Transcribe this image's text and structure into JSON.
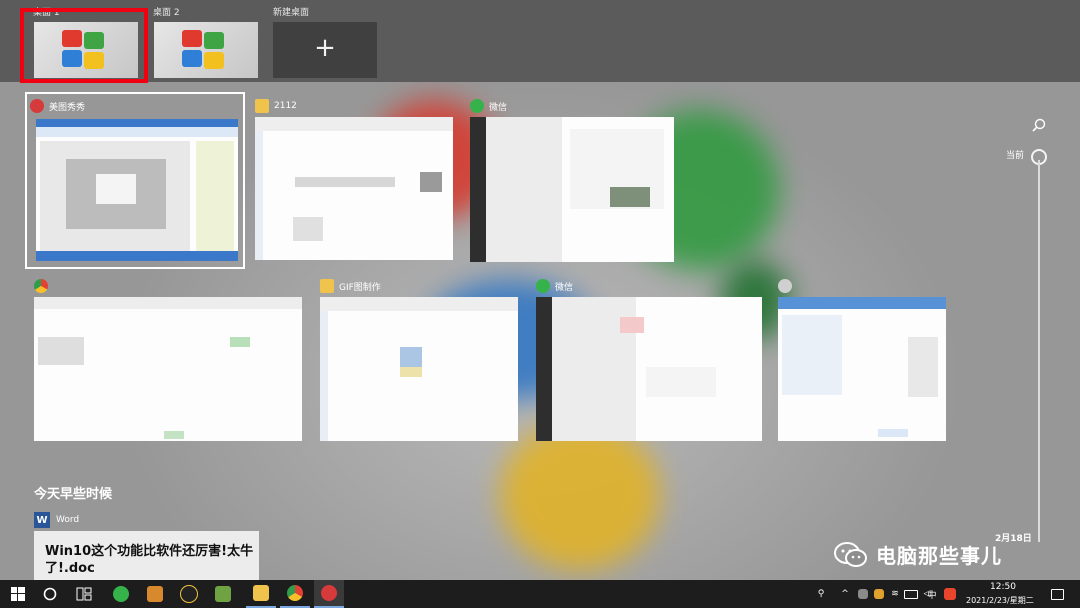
{
  "desktops": {
    "items": [
      {
        "label": "桌面 1",
        "selected": true
      },
      {
        "label": "桌面 2",
        "selected": false
      }
    ],
    "new_label": "新建桌面",
    "new_icon": "plus-icon"
  },
  "windows": [
    {
      "title": "美图秀秀",
      "icon": "meitu-icon",
      "selected": true
    },
    {
      "title": "2112",
      "icon": "folder-icon"
    },
    {
      "title": "微信",
      "icon": "wechat-icon"
    },
    {
      "title": "",
      "icon": "chrome-icon"
    },
    {
      "title": "GIF图制作",
      "icon": "folder-icon"
    },
    {
      "title": "微信",
      "icon": "wechat-icon"
    },
    {
      "title": "",
      "icon": "app-icon"
    }
  ],
  "timeline": {
    "now_label": "当前",
    "date_label": "2月18日",
    "search_icon": "search-icon"
  },
  "earlier": {
    "heading": "今天早些时候",
    "app_label": "Word",
    "doc_title": "Win10这个功能比软件还厉害!太牛了!.doc"
  },
  "watermark": {
    "text": "电脑那些事儿"
  },
  "taskbar": {
    "time": "12:50",
    "date": "2021/2/23/星期二",
    "ime_label": "中",
    "apps": [
      "start-icon",
      "search-circle-icon",
      "task-view-icon",
      "wechat-icon",
      "toolbox-icon",
      "qq-icon",
      "minecraft-icon",
      "explorer-icon",
      "chrome-icon",
      "meitu-icon"
    ]
  },
  "colors": {
    "selection": "#f00010",
    "taskbar": "#1d1d1d",
    "desk_bar": "#5b5b5b"
  }
}
